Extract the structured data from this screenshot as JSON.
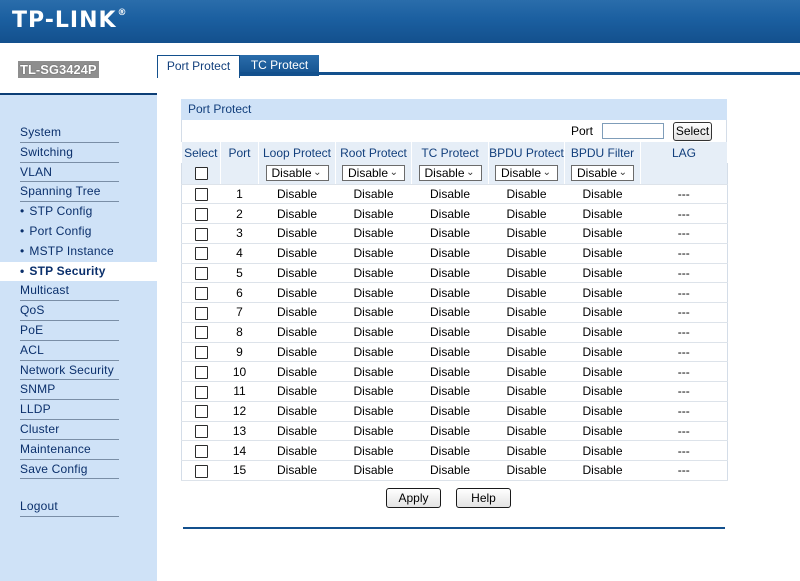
{
  "brand": {
    "logo": "TP-LINK",
    "reg": "®",
    "model": "TL-SG3424P"
  },
  "tabs": [
    {
      "label": "Port Protect"
    },
    {
      "label": "TC Protect"
    }
  ],
  "sidebar": {
    "items": [
      {
        "label": "System"
      },
      {
        "label": "Switching"
      },
      {
        "label": "VLAN"
      },
      {
        "label": "Spanning Tree"
      },
      {
        "label": "STP Config"
      },
      {
        "label": "Port Config"
      },
      {
        "label": "MSTP Instance"
      },
      {
        "label": "STP Security"
      },
      {
        "label": "Multicast"
      },
      {
        "label": "QoS"
      },
      {
        "label": "PoE"
      },
      {
        "label": "ACL"
      },
      {
        "label": "Network Security"
      },
      {
        "label": "SNMP"
      },
      {
        "label": "LLDP"
      },
      {
        "label": "Cluster"
      },
      {
        "label": "Maintenance"
      },
      {
        "label": "Save Config"
      },
      {
        "label": "Logout"
      }
    ],
    "bullet": "•"
  },
  "panel": {
    "title": "Port Protect",
    "port_label": "Port",
    "port_value": "",
    "select_button": "Select",
    "columns": [
      "Select",
      "Port",
      "Loop Protect",
      "Root Protect",
      "TC Protect",
      "BPDU Protect",
      "BPDU Filter",
      "LAG"
    ],
    "control_values": [
      "Disable",
      "Disable",
      "Disable",
      "Disable",
      "Disable"
    ],
    "rows": [
      {
        "port": "1",
        "loop": "Disable",
        "root": "Disable",
        "tc": "Disable",
        "bpdu_protect": "Disable",
        "bpdu_filter": "Disable",
        "lag": "---"
      },
      {
        "port": "2",
        "loop": "Disable",
        "root": "Disable",
        "tc": "Disable",
        "bpdu_protect": "Disable",
        "bpdu_filter": "Disable",
        "lag": "---"
      },
      {
        "port": "3",
        "loop": "Disable",
        "root": "Disable",
        "tc": "Disable",
        "bpdu_protect": "Disable",
        "bpdu_filter": "Disable",
        "lag": "---"
      },
      {
        "port": "4",
        "loop": "Disable",
        "root": "Disable",
        "tc": "Disable",
        "bpdu_protect": "Disable",
        "bpdu_filter": "Disable",
        "lag": "---"
      },
      {
        "port": "5",
        "loop": "Disable",
        "root": "Disable",
        "tc": "Disable",
        "bpdu_protect": "Disable",
        "bpdu_filter": "Disable",
        "lag": "---"
      },
      {
        "port": "6",
        "loop": "Disable",
        "root": "Disable",
        "tc": "Disable",
        "bpdu_protect": "Disable",
        "bpdu_filter": "Disable",
        "lag": "---"
      },
      {
        "port": "7",
        "loop": "Disable",
        "root": "Disable",
        "tc": "Disable",
        "bpdu_protect": "Disable",
        "bpdu_filter": "Disable",
        "lag": "---"
      },
      {
        "port": "8",
        "loop": "Disable",
        "root": "Disable",
        "tc": "Disable",
        "bpdu_protect": "Disable",
        "bpdu_filter": "Disable",
        "lag": "---"
      },
      {
        "port": "9",
        "loop": "Disable",
        "root": "Disable",
        "tc": "Disable",
        "bpdu_protect": "Disable",
        "bpdu_filter": "Disable",
        "lag": "---"
      },
      {
        "port": "10",
        "loop": "Disable",
        "root": "Disable",
        "tc": "Disable",
        "bpdu_protect": "Disable",
        "bpdu_filter": "Disable",
        "lag": "---"
      },
      {
        "port": "11",
        "loop": "Disable",
        "root": "Disable",
        "tc": "Disable",
        "bpdu_protect": "Disable",
        "bpdu_filter": "Disable",
        "lag": "---"
      },
      {
        "port": "12",
        "loop": "Disable",
        "root": "Disable",
        "tc": "Disable",
        "bpdu_protect": "Disable",
        "bpdu_filter": "Disable",
        "lag": "---"
      },
      {
        "port": "13",
        "loop": "Disable",
        "root": "Disable",
        "tc": "Disable",
        "bpdu_protect": "Disable",
        "bpdu_filter": "Disable",
        "lag": "---"
      },
      {
        "port": "14",
        "loop": "Disable",
        "root": "Disable",
        "tc": "Disable",
        "bpdu_protect": "Disable",
        "bpdu_filter": "Disable",
        "lag": "---"
      },
      {
        "port": "15",
        "loop": "Disable",
        "root": "Disable",
        "tc": "Disable",
        "bpdu_protect": "Disable",
        "bpdu_filter": "Disable",
        "lag": "---"
      }
    ],
    "apply_button": "Apply",
    "help_button": "Help"
  },
  "icons": {
    "dropdown": "chevron-down-icon",
    "checkbox": "checkbox-icon"
  },
  "colors": {
    "banner": "#1b5fa0",
    "sidebar": "#cfe2f7",
    "header_row": "#e6eef7",
    "link": "#0a2f6b"
  }
}
